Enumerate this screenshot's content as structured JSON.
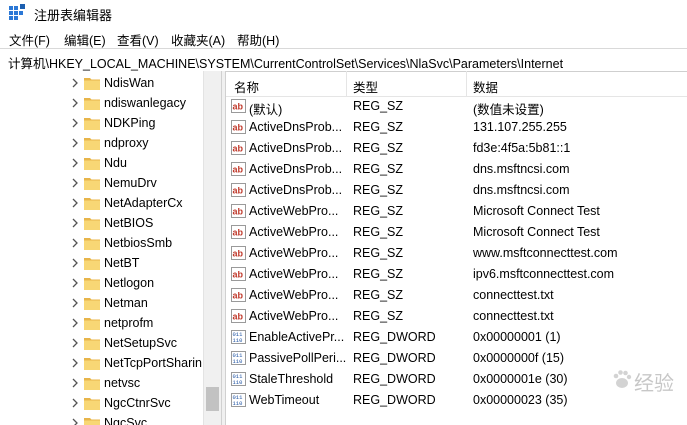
{
  "window": {
    "title": "注册表编辑器",
    "app_icon": "regedit-icon"
  },
  "menu": [
    "文件(F)",
    "编辑(E)",
    "查看(V)",
    "收藏夹(A)",
    "帮助(H)"
  ],
  "address": "计算机\\HKEY_LOCAL_MACHINE\\SYSTEM\\CurrentControlSet\\Services\\NlaSvc\\Parameters\\Internet",
  "tree": {
    "items": [
      "NdisWan",
      "ndiswanlegacy",
      "NDKPing",
      "ndproxy",
      "Ndu",
      "NemuDrv",
      "NetAdapterCx",
      "NetBIOS",
      "NetbiosSmb",
      "NetBT",
      "Netlogon",
      "Netman",
      "netprofm",
      "NetSetupSvc",
      "NetTcpPortSharin",
      "netvsc",
      "NgcCtnrSvc",
      "NgcSvc"
    ]
  },
  "columns": {
    "name": "名称",
    "type": "类型",
    "data": "数据"
  },
  "values": [
    {
      "icon": "string-value-icon",
      "name": "(默认)",
      "type": "REG_SZ",
      "data": "(数值未设置)"
    },
    {
      "icon": "string-value-icon",
      "name": "ActiveDnsProb...",
      "type": "REG_SZ",
      "data": "131.107.255.255"
    },
    {
      "icon": "string-value-icon",
      "name": "ActiveDnsProb...",
      "type": "REG_SZ",
      "data": "fd3e:4f5a:5b81::1"
    },
    {
      "icon": "string-value-icon",
      "name": "ActiveDnsProb...",
      "type": "REG_SZ",
      "data": "dns.msftncsi.com"
    },
    {
      "icon": "string-value-icon",
      "name": "ActiveDnsProb...",
      "type": "REG_SZ",
      "data": "dns.msftncsi.com"
    },
    {
      "icon": "string-value-icon",
      "name": "ActiveWebPro...",
      "type": "REG_SZ",
      "data": "Microsoft Connect Test"
    },
    {
      "icon": "string-value-icon",
      "name": "ActiveWebPro...",
      "type": "REG_SZ",
      "data": "Microsoft Connect Test"
    },
    {
      "icon": "string-value-icon",
      "name": "ActiveWebPro...",
      "type": "REG_SZ",
      "data": "www.msftconnecttest.com"
    },
    {
      "icon": "string-value-icon",
      "name": "ActiveWebPro...",
      "type": "REG_SZ",
      "data": "ipv6.msftconnecttest.com"
    },
    {
      "icon": "string-value-icon",
      "name": "ActiveWebPro...",
      "type": "REG_SZ",
      "data": "connecttest.txt"
    },
    {
      "icon": "string-value-icon",
      "name": "ActiveWebPro...",
      "type": "REG_SZ",
      "data": "connecttest.txt"
    },
    {
      "icon": "dword-value-icon",
      "name": "EnableActivePr...",
      "type": "REG_DWORD",
      "data": "0x00000001 (1)"
    },
    {
      "icon": "dword-value-icon",
      "name": "PassivePollPeri...",
      "type": "REG_DWORD",
      "data": "0x0000000f (15)"
    },
    {
      "icon": "dword-value-icon",
      "name": "StaleThreshold",
      "type": "REG_DWORD",
      "data": "0x0000001e (30)"
    },
    {
      "icon": "dword-value-icon",
      "name": "WebTimeout",
      "type": "REG_DWORD",
      "data": "0x00000023 (35)"
    }
  ],
  "watermark": {
    "text": "经验",
    "icon": "baidu-paw-icon"
  }
}
